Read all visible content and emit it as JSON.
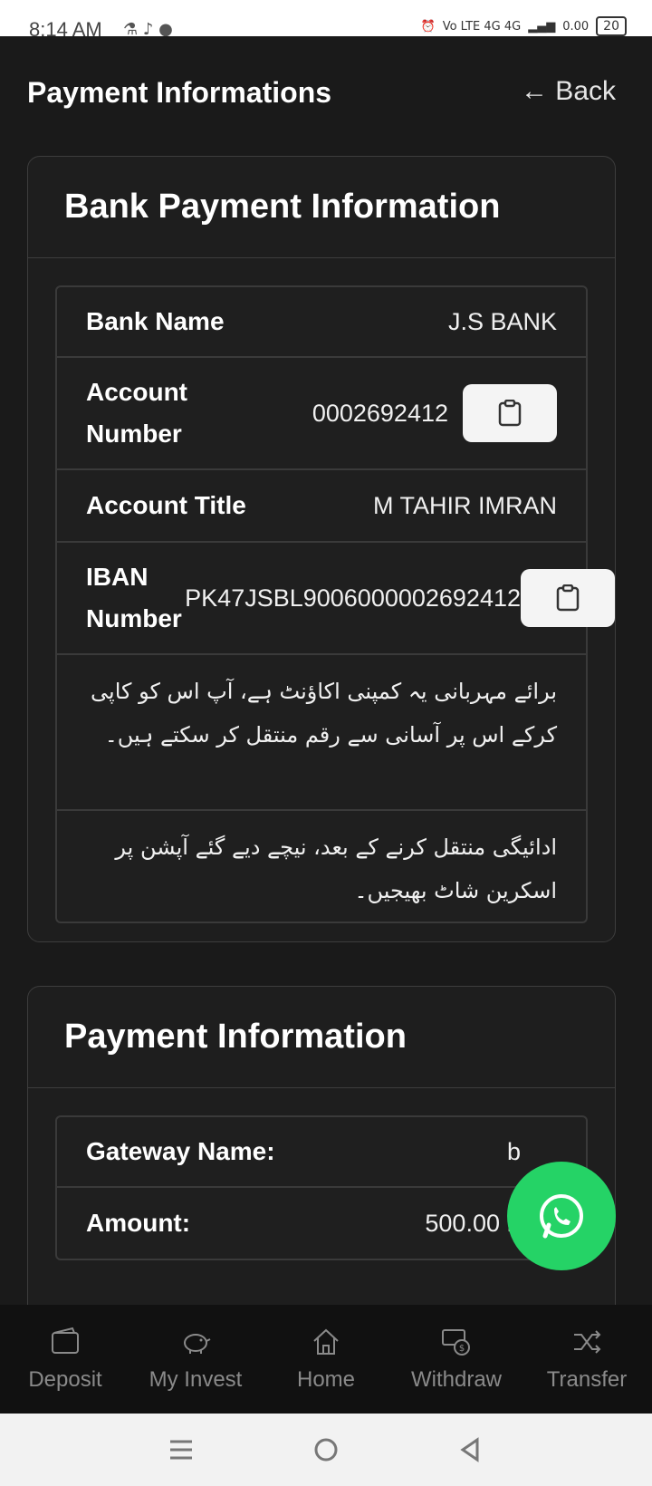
{
  "status_bar": {
    "time": "8:14 AM",
    "network": "Vo LTE 4G 4G",
    "speed": "0.00",
    "battery": "20"
  },
  "header": {
    "title": "Payment Informations",
    "back_label": "← Back"
  },
  "bank_card": {
    "title": "Bank Payment Information",
    "rows": [
      {
        "label": "Bank Name",
        "value": "J.S BANK"
      },
      {
        "label": "Account Number",
        "value": "0002692412"
      },
      {
        "label": "Account Title",
        "value": "M TAHIR IMRAN"
      },
      {
        "label": "IBAN Number",
        "value": "PK47JSBL9006000002692412"
      }
    ],
    "note_1": "برائے مہربانی یہ کمپنی اکاؤنٹ ہے، آپ اس کو کاپی کرکے اس پر آسانی سے رقم منتقل کر سکتے ہیں۔",
    "note_2": "ادائیگی منتقل کرنے کے بعد، نیچے دیے گئے آپشن پر اسکرین شاٹ بھیجیں۔"
  },
  "payment_card": {
    "title": "Payment Information",
    "rows": [
      {
        "label": "Gateway Name:",
        "value": "b"
      },
      {
        "label": "Amount:",
        "value": "500.00 PKR"
      }
    ]
  },
  "bottom_nav": {
    "items": [
      {
        "label": "Deposit",
        "icon": "wallet-icon"
      },
      {
        "label": "My Invest",
        "icon": "piggy-bank-icon"
      },
      {
        "label": "Home",
        "icon": "home-icon"
      },
      {
        "label": "Withdraw",
        "icon": "cash-icon"
      },
      {
        "label": "Transfer",
        "icon": "shuffle-icon"
      }
    ]
  },
  "colors": {
    "background": "#1a1a1a",
    "whatsapp": "#25d366",
    "copy_button": "#f4f4f4"
  }
}
